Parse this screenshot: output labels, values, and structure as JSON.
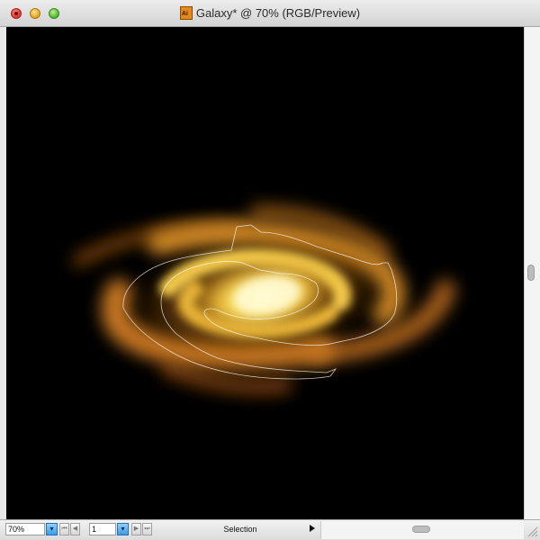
{
  "window": {
    "title": "Galaxy* @ 70% (RGB/Preview)",
    "doc_icon_label": "Ai"
  },
  "status": {
    "zoom_value": "70%",
    "page_value": "1",
    "tool_label": "Selection"
  },
  "colors": {
    "canvas_background": "#000000",
    "galaxy_core": "#fff6a0",
    "galaxy_arm": "#c87a20",
    "selection_path": "#ffffff",
    "dropdown_accent": "#3a9bea"
  },
  "icons": {
    "close": "close-icon",
    "minimize": "minimize-icon",
    "zoom": "zoom-icon",
    "document": "illustrator-document-icon",
    "first_page": "first-page-icon",
    "prev_page": "previous-page-icon",
    "next_page": "next-page-icon",
    "last_page": "last-page-icon"
  }
}
